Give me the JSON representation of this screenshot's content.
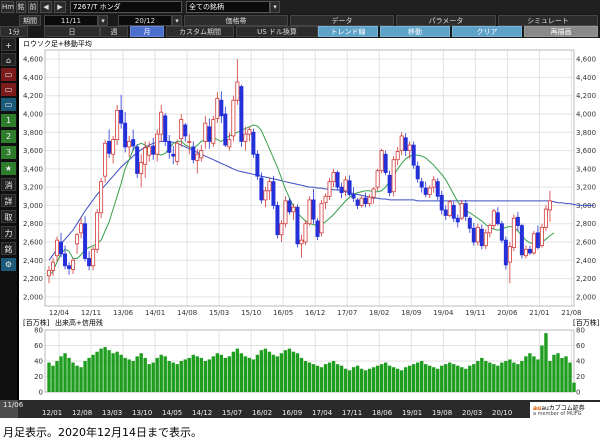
{
  "toolbar": {
    "hm": "Hm",
    "k1": "銘",
    "k2": "前",
    "code": "7267/T ホンダ",
    "universe": "全ての銘柄",
    "period_label": "期間",
    "from": "11/11",
    "to": "20/12",
    "tabs": [
      "価格帯",
      "データ",
      "パラメータ",
      "シミュレート"
    ],
    "intervals": [
      "1分",
      "日",
      "週",
      "月"
    ],
    "menu": [
      "カスタム期間",
      "US ドル換算",
      "トレンド線",
      "移動",
      "クリア",
      "再描画"
    ]
  },
  "sidebar": [
    "+",
    "⌂",
    "▭",
    "▭",
    "▭",
    "1",
    "2",
    "3",
    "★",
    "消",
    "詳",
    "取",
    "力",
    "銘",
    "⚙"
  ],
  "chart_data": [
    {
      "type": "candlestick",
      "title": "ロウソク足+移動平均",
      "x_tick_labels": [
        "12/04",
        "12/11",
        "13/06",
        "14/01",
        "14/08",
        "15/03",
        "15/10",
        "16/05",
        "16/12",
        "17/07",
        "18/02",
        "18/09",
        "19/04",
        "19/11",
        "20/06",
        "21/01",
        "21/08"
      ],
      "ylim": [
        1900,
        4700
      ],
      "y_tick_labels": [
        "2,000",
        "2,200",
        "2,400",
        "2,600",
        "2,800",
        "3,000",
        "3,200",
        "3,400",
        "3,600",
        "3,800",
        "4,000",
        "4,200",
        "4,400",
        "4,600"
      ],
      "grid": true,
      "ohlc": [
        [
          2230,
          2340,
          2150,
          2290
        ],
        [
          2290,
          2430,
          2230,
          2380
        ],
        [
          2450,
          2660,
          2390,
          2620
        ],
        [
          2600,
          2700,
          2430,
          2470
        ],
        [
          2470,
          2560,
          2300,
          2340
        ],
        [
          2340,
          2380,
          2240,
          2310
        ],
        [
          2300,
          2420,
          2250,
          2400
        ],
        [
          2580,
          2700,
          2470,
          2680
        ],
        [
          2700,
          2870,
          2640,
          2800
        ],
        [
          2800,
          2880,
          2390,
          2420
        ],
        [
          2420,
          2500,
          2290,
          2340
        ],
        [
          2340,
          2550,
          2290,
          2520
        ],
        [
          2520,
          2960,
          2480,
          2920
        ],
        [
          2920,
          3300,
          2860,
          3260
        ],
        [
          3320,
          3720,
          3250,
          3680
        ],
        [
          3700,
          3830,
          3520,
          3570
        ],
        [
          3560,
          3760,
          3460,
          3720
        ],
        [
          3720,
          4100,
          3660,
          4040
        ],
        [
          4040,
          4210,
          3840,
          3900
        ],
        [
          3900,
          4020,
          3580,
          3640
        ],
        [
          3640,
          3760,
          3530,
          3700
        ],
        [
          3720,
          3830,
          3600,
          3650
        ],
        [
          3640,
          3670,
          3300,
          3350
        ],
        [
          3350,
          3560,
          3200,
          3470
        ],
        [
          3450,
          3700,
          3300,
          3630
        ],
        [
          3550,
          3700,
          3480,
          3640
        ],
        [
          3650,
          3740,
          3500,
          3560
        ],
        [
          3560,
          3830,
          3480,
          3780
        ],
        [
          3780,
          4100,
          3700,
          4020
        ],
        [
          3980,
          4010,
          3650,
          3700
        ],
        [
          3700,
          3770,
          3510,
          3580
        ],
        [
          3560,
          3650,
          3450,
          3540
        ],
        [
          3480,
          3720,
          3440,
          3680
        ],
        [
          3730,
          4000,
          3640,
          3940
        ],
        [
          3880,
          3900,
          3700,
          3760
        ],
        [
          3700,
          3780,
          3560,
          3700
        ],
        [
          3640,
          3700,
          3460,
          3500
        ],
        [
          3490,
          3620,
          3350,
          3560
        ],
        [
          3520,
          3660,
          3480,
          3600
        ],
        [
          3700,
          3980,
          3620,
          3900
        ],
        [
          3860,
          3950,
          3620,
          3700
        ],
        [
          3680,
          3980,
          3640,
          3940
        ],
        [
          3950,
          4240,
          3900,
          4170
        ],
        [
          4150,
          4250,
          3900,
          3980
        ],
        [
          4000,
          4080,
          3640,
          3660
        ],
        [
          3640,
          3800,
          3600,
          3720
        ],
        [
          3760,
          4200,
          3700,
          4150
        ],
        [
          4150,
          4600,
          4100,
          4350
        ],
        [
          4300,
          4320,
          3640,
          3700
        ],
        [
          3700,
          3860,
          3600,
          3780
        ],
        [
          3780,
          3860,
          3700,
          3830
        ],
        [
          3800,
          3840,
          3520,
          3560
        ],
        [
          3560,
          3600,
          3280,
          3320
        ],
        [
          3300,
          3360,
          3020,
          3060
        ],
        [
          3060,
          3200,
          2980,
          3160
        ],
        [
          3160,
          3300,
          3060,
          3260
        ],
        [
          3260,
          3320,
          2960,
          3000
        ],
        [
          3000,
          3040,
          2640,
          2680
        ],
        [
          2680,
          2840,
          2600,
          2800
        ],
        [
          2800,
          3100,
          2760,
          3050
        ],
        [
          3050,
          3080,
          2900,
          2930
        ],
        [
          2930,
          3020,
          2840,
          2980
        ],
        [
          2980,
          3010,
          2540,
          2580
        ],
        [
          2580,
          2680,
          2430,
          2620
        ],
        [
          2600,
          2840,
          2570,
          2800
        ],
        [
          2800,
          3100,
          2780,
          3060
        ],
        [
          3060,
          3180,
          2800,
          2850
        ],
        [
          2830,
          2860,
          2620,
          2660
        ],
        [
          2700,
          3060,
          2660,
          3020
        ],
        [
          3030,
          3130,
          2960,
          3100
        ],
        [
          3100,
          3300,
          3060,
          3260
        ],
        [
          3260,
          3400,
          3200,
          3360
        ],
        [
          3360,
          3380,
          3170,
          3200
        ],
        [
          3200,
          3250,
          3080,
          3140
        ],
        [
          3160,
          3320,
          3100,
          3280
        ],
        [
          3270,
          3330,
          3100,
          3120
        ],
        [
          3120,
          3200,
          3040,
          3080
        ],
        [
          3060,
          3080,
          2960,
          3000
        ],
        [
          3000,
          3100,
          2980,
          3080
        ],
        [
          3080,
          3140,
          2980,
          3020
        ],
        [
          3020,
          3120,
          2990,
          3090
        ],
        [
          3090,
          3200,
          3020,
          3180
        ],
        [
          3200,
          3400,
          3160,
          3380
        ],
        [
          3380,
          3620,
          3350,
          3600
        ],
        [
          3560,
          3600,
          3330,
          3360
        ],
        [
          3330,
          3380,
          3100,
          3140
        ],
        [
          3150,
          3540,
          3100,
          3500
        ],
        [
          3500,
          3640,
          3440,
          3590
        ],
        [
          3600,
          3800,
          3550,
          3760
        ],
        [
          3740,
          3790,
          3540,
          3600
        ],
        [
          3600,
          3700,
          3510,
          3660
        ],
        [
          3660,
          3700,
          3400,
          3440
        ],
        [
          3430,
          3480,
          3250,
          3290
        ],
        [
          3260,
          3300,
          3140,
          3200
        ],
        [
          3190,
          3260,
          3090,
          3120
        ],
        [
          3120,
          3220,
          3080,
          3190
        ],
        [
          3200,
          3320,
          3140,
          3280
        ],
        [
          3260,
          3300,
          3060,
          3100
        ],
        [
          3110,
          3160,
          2900,
          2950
        ],
        [
          2950,
          3000,
          2840,
          2890
        ],
        [
          2890,
          3060,
          2870,
          3040
        ],
        [
          3000,
          3040,
          2820,
          2860
        ],
        [
          2860,
          2900,
          2760,
          2820
        ],
        [
          2860,
          3060,
          2840,
          3020
        ],
        [
          3020,
          3060,
          2830,
          2880
        ],
        [
          2860,
          2880,
          2700,
          2750
        ],
        [
          2750,
          2810,
          2560,
          2600
        ],
        [
          2600,
          2800,
          2560,
          2760
        ],
        [
          2740,
          2790,
          2520,
          2560
        ],
        [
          2560,
          2740,
          2520,
          2700
        ],
        [
          2700,
          2800,
          2650,
          2780
        ],
        [
          2780,
          2960,
          2740,
          2940
        ],
        [
          2920,
          2980,
          2780,
          2800
        ],
        [
          2800,
          2830,
          2590,
          2620
        ],
        [
          2620,
          2660,
          2300,
          2350
        ],
        [
          2380,
          2600,
          2150,
          2550
        ],
        [
          2540,
          2900,
          2500,
          2860
        ],
        [
          2870,
          2930,
          2720,
          2780
        ],
        [
          2780,
          2800,
          2420,
          2460
        ],
        [
          2450,
          2560,
          2420,
          2520
        ],
        [
          2520,
          2560,
          2460,
          2480
        ],
        [
          2480,
          2720,
          2460,
          2690
        ],
        [
          2700,
          2780,
          2520,
          2540
        ],
        [
          2560,
          2800,
          2540,
          2760
        ],
        [
          2760,
          3000,
          2720,
          2960
        ],
        [
          2950,
          3160,
          2820,
          3050
        ]
      ],
      "ma_short": [
        2230,
        2280,
        2380,
        2470,
        2520,
        2500,
        2420,
        2420,
        2460,
        2520,
        2540,
        2560,
        2580,
        2620,
        2720,
        2820,
        2960,
        3100,
        3240,
        3400,
        3500,
        3610,
        3660,
        3680,
        3660,
        3600,
        3580,
        3560,
        3550,
        3570,
        3620,
        3680,
        3700,
        3700,
        3660,
        3640,
        3620,
        3660,
        3700,
        3720,
        3730,
        3740,
        3720,
        3700,
        3730,
        3760,
        3780,
        3800,
        3820,
        3840,
        3860,
        3880,
        3870,
        3820,
        3720,
        3620,
        3520,
        3420,
        3300,
        3180,
        3080,
        2990,
        2920,
        2870,
        2830,
        2800,
        2790,
        2780,
        2790,
        2820,
        2860,
        2900,
        2950,
        3000,
        3050,
        3090,
        3120,
        3140,
        3150,
        3160,
        3160,
        3150,
        3150,
        3160,
        3200,
        3260,
        3330,
        3400,
        3460,
        3510,
        3540,
        3550,
        3550,
        3540,
        3520,
        3480,
        3440,
        3390,
        3340,
        3280,
        3200,
        3120,
        3040,
        2980,
        2940,
        2920,
        2890,
        2860,
        2830,
        2790,
        2760,
        2740,
        2730,
        2740,
        2760,
        2770,
        2760,
        2720,
        2670,
        2620,
        2590,
        2580,
        2580,
        2600,
        2630,
        2670,
        2700
      ],
      "ma_long": [
        2400,
        2460,
        2520,
        2580,
        2630,
        2680,
        2730,
        2800,
        2870,
        2940,
        3000,
        3060,
        3120,
        3170,
        3220,
        3270,
        3320,
        3370,
        3420,
        3460,
        3500,
        3540,
        3580,
        3610,
        3640,
        3660,
        3680,
        3690,
        3700,
        3700,
        3700,
        3690,
        3680,
        3660,
        3640,
        3620,
        3600,
        3580,
        3560,
        3540,
        3520,
        3500,
        3480,
        3460,
        3440,
        3420,
        3400,
        3380,
        3370,
        3360,
        3350,
        3340,
        3330,
        3320,
        3310,
        3300,
        3290,
        3280,
        3270,
        3260,
        3250,
        3240,
        3230,
        3220,
        3210,
        3200,
        3200,
        3190,
        3190,
        3180,
        3180,
        3170,
        3170,
        3160,
        3150,
        3140,
        3130,
        3120,
        3110,
        3100,
        3090,
        3080,
        3080,
        3070,
        3070,
        3060,
        3060,
        3060,
        3060,
        3060,
        3060,
        3060,
        3050,
        3050,
        3050,
        3050,
        3050,
        3050,
        3050,
        3050,
        3050,
        3050,
        3050,
        3050,
        3050,
        3050,
        3050,
        3050,
        3050,
        3050,
        3050,
        3050,
        3050,
        3050,
        3050,
        3050,
        3050,
        3050,
        3050,
        3050,
        3050,
        3050,
        3050,
        3050,
        3050,
        3050,
        3040,
        3030,
        3030,
        3020,
        3020,
        3010,
        3000,
        3000,
        3000,
        3000,
        3000
      ]
    },
    {
      "type": "bar",
      "title": "出来高+信用残",
      "y_axis_label": "[百万株]",
      "ylim": [
        0,
        80
      ],
      "y_tick_labels": [
        "0",
        "20",
        "40",
        "60",
        "80"
      ],
      "volume": [
        38,
        34,
        40,
        46,
        50,
        44,
        38,
        34,
        32,
        40,
        44,
        48,
        52,
        56,
        58,
        54,
        50,
        52,
        48,
        44,
        42,
        40,
        46,
        50,
        44,
        36,
        38,
        44,
        48,
        46,
        40,
        38,
        36,
        40,
        42,
        44,
        48,
        46,
        44,
        40,
        42,
        46,
        50,
        48,
        44,
        46,
        52,
        56,
        50,
        46,
        44,
        42,
        48,
        54,
        56,
        52,
        48,
        46,
        50,
        54,
        56,
        52,
        50,
        44,
        40,
        38,
        36,
        34,
        32,
        36,
        38,
        40,
        36,
        34,
        30,
        28,
        32,
        34,
        30,
        28,
        30,
        32,
        34,
        36,
        38,
        34,
        32,
        30,
        28,
        32,
        34,
        36,
        38,
        40,
        36,
        34,
        32,
        30,
        34,
        36,
        38,
        36,
        34,
        32,
        30,
        34,
        36,
        40,
        44,
        40,
        38,
        36,
        34,
        38,
        40,
        42,
        38,
        36,
        40,
        46,
        50,
        46,
        42,
        60,
        76,
        40,
        48,
        50,
        44,
        46,
        38,
        12
      ]
    }
  ],
  "bottom": {
    "labels": [
      "11/06",
      "12/01",
      "12/08",
      "13/03",
      "13/10",
      "14/05",
      "14/12",
      "15/07",
      "16/02",
      "16/09",
      "17/04",
      "17/11",
      "18/06",
      "19/01",
      "19/08",
      "20/03",
      "20/10"
    ],
    "company": "auカブコム証券",
    "company_sub": "a member of MUFG"
  },
  "caption": "月足表示。2020年12月14日まで表示。"
}
